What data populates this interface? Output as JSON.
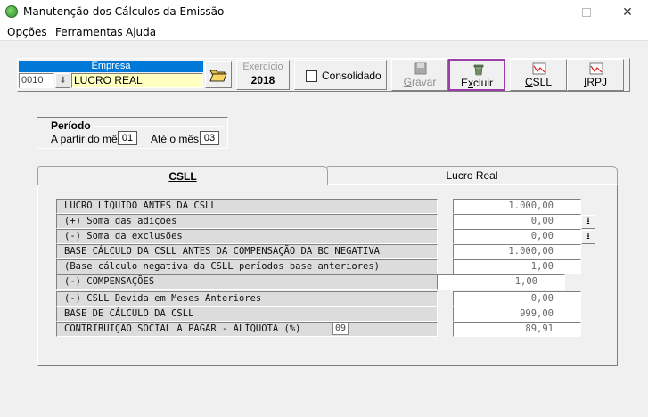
{
  "window": {
    "title": "Manutenção dos Cálculos da Emissão"
  },
  "menu": {
    "items": [
      "Opções",
      "Ferramentas",
      "Ajuda"
    ]
  },
  "empresa": {
    "header": "Empresa",
    "code": "0010",
    "name": "LUCRO REAL"
  },
  "exercicio": {
    "label": "Exercício",
    "value": "2018"
  },
  "consolidado": {
    "label": "Consolidado",
    "checked": false
  },
  "toolbar": {
    "gravar_label": "Gravar",
    "excluir_label": "Excluir",
    "csll_label": "CSLL",
    "irpj_label": "IRPJ"
  },
  "periodo": {
    "title": "Período",
    "apartir_label": "A partir do mês",
    "apartir_value": "01",
    "ate_label": "Até o mês",
    "ate_value": "03"
  },
  "tabs": {
    "csll": "CSLL",
    "lucro_real": "Lucro Real"
  },
  "rows": [
    {
      "label": "LUCRO LÍQUIDO ANTES DA CSLL",
      "value": "1.000,00"
    },
    {
      "label": "(+) Soma das adições",
      "value": "0,00"
    },
    {
      "label": "(-) Soma da exclusões",
      "value": "0,00"
    },
    {
      "label": "BASE CÁLCULO DA CSLL ANTES DA COMPENSAÇÃO DA BC NEGATIVA",
      "value": "1.000,00"
    },
    {
      "label": "(Base cálculo negativa da CSLL períodos base anteriores)",
      "value": "1,00"
    },
    {
      "label": "(-) COMPENSAÇÕES",
      "value": "1,00"
    },
    {
      "label": "(-) CSLL Devida em Meses Anteriores",
      "value": "0,00"
    },
    {
      "label": "BASE DE CÁLCULO DA CSLL",
      "value": "999,00"
    },
    {
      "label": "CONTRIBUIÇÃO SOCIAL A PAGAR - ALÍQUOTA (%)",
      "value": "89,91"
    }
  ],
  "aliquota": "09",
  "colors": {
    "accent": "#0078d7",
    "highlight_border": "#9b3fa8",
    "input_yellow": "#ffffc0"
  }
}
